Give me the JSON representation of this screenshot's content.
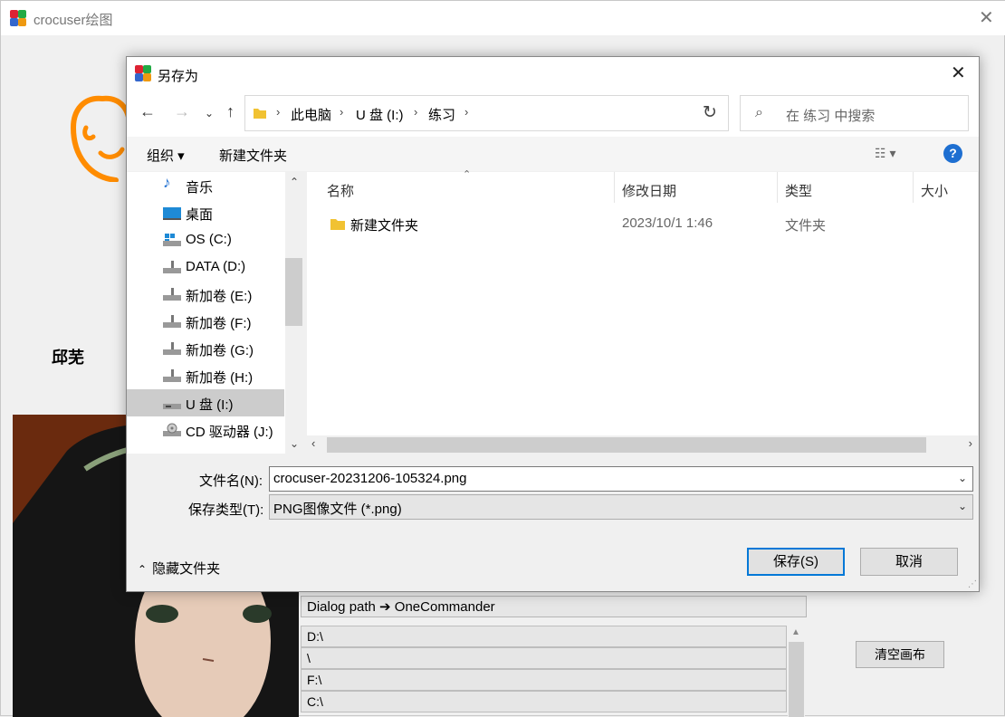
{
  "main": {
    "title": "crocuser绘图",
    "author": "邱芜",
    "clear_button": "清空画布",
    "dialog_path_label": "Dialog path ➔ OneCommander",
    "paths": [
      "D:\\",
      "\\",
      "F:\\",
      "C:\\"
    ]
  },
  "dialog": {
    "title": "另存为",
    "breadcrumb": [
      "此电脑",
      "U 盘 (I:)",
      "练习"
    ],
    "search_placeholder": "在 练习 中搜索",
    "toolbar": {
      "organize": "组织 ▾",
      "new_folder": "新建文件夹"
    },
    "nav_items": [
      {
        "label": "音乐",
        "icon": "music-icon"
      },
      {
        "label": "桌面",
        "icon": "desktop-icon"
      },
      {
        "label": "OS (C:)",
        "icon": "os-drive-icon"
      },
      {
        "label": "DATA (D:)",
        "icon": "drive-icon"
      },
      {
        "label": "新加卷 (E:)",
        "icon": "drive-icon"
      },
      {
        "label": "新加卷 (F:)",
        "icon": "drive-icon"
      },
      {
        "label": "新加卷 (G:)",
        "icon": "drive-icon"
      },
      {
        "label": "新加卷 (H:)",
        "icon": "drive-icon"
      },
      {
        "label": "U 盘 (I:)",
        "icon": "usb-drive-icon",
        "selected": true
      },
      {
        "label": "CD 驱动器 (J:)",
        "icon": "cd-drive-icon"
      }
    ],
    "columns": [
      "名称",
      "修改日期",
      "类型",
      "大小"
    ],
    "files": [
      {
        "name": "新建文件夹",
        "date": "2023/10/1 1:46",
        "type": "文件夹",
        "size": ""
      }
    ],
    "filename_label": "文件名(N):",
    "filename_value": "crocuser-20231206-105324.png",
    "filetype_label": "保存类型(T):",
    "filetype_value": "PNG图像文件  (*.png)",
    "hide_folders": "隐藏文件夹",
    "save": "保存(S)",
    "cancel": "取消"
  },
  "colors": {
    "accent": "#0078d7",
    "doodle": "#ff8c00",
    "help": "#1e6fd1"
  }
}
